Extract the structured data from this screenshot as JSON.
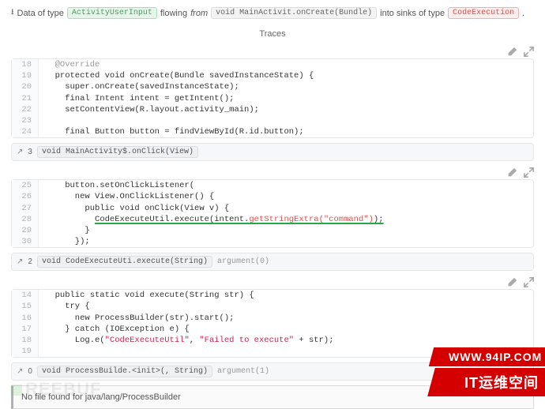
{
  "header": {
    "prefix": "Data of type",
    "sourceTag": "ActivityUserInput",
    "mid1": "flowing",
    "mid1i": "from",
    "methodTag": "void MainActivit.onCreate(Bundle)",
    "mid2": "into sinks of type",
    "sinkTag": "CodeExecution",
    "period": "."
  },
  "tracesTitle": "Traces",
  "code1": [
    {
      "n": "18",
      "t": "  @Override",
      "cls": "ann"
    },
    {
      "n": "19",
      "t": "  protected void onCreate(Bundle savedInstanceState) {"
    },
    {
      "n": "20",
      "t": "    super.onCreate(savedInstanceState);"
    },
    {
      "n": "21",
      "t": "    final Intent intent = getIntent();"
    },
    {
      "n": "22",
      "t": "    setContentView(R.layout.activity_main);"
    },
    {
      "n": "23",
      "t": ""
    },
    {
      "n": "24",
      "t": "    final Button button = findViewById(R.id.button);"
    }
  ],
  "sep1": {
    "num": "3",
    "code": "void MainActivity$.onClick(View)"
  },
  "code2": [
    {
      "n": "25",
      "t": "    button.setOnClickListener("
    },
    {
      "n": "26",
      "t": "      new View.OnClickListener() {"
    },
    {
      "n": "27",
      "t": "        public void onClick(View v) {"
    },
    {
      "n": "28",
      "pre": "          ",
      "u1": "CodeExecuteUtil.execute(",
      "u2": "intent.",
      "hl": "getStringExtra(\"command\")",
      "u3": ");"
    },
    {
      "n": "29",
      "t": "        }"
    },
    {
      "n": "30",
      "t": "      });"
    },
    {
      "n": "",
      "t": ""
    }
  ],
  "sep2": {
    "num": "2",
    "code": "void CodeExecuteUti.execute(String)",
    "arg": "argument(0)"
  },
  "code3": [
    {
      "n": "14",
      "t": "  public static void execute(String str) {"
    },
    {
      "n": "15",
      "t": "    try {"
    },
    {
      "n": "16",
      "t": "      new ProcessBuilder(str).start();"
    },
    {
      "n": "17",
      "t": "    } catch (IOException e) {"
    },
    {
      "n": "18",
      "pre": "      Log.e(",
      "s1": "\"CodeExecuteUtil\"",
      "c": ", ",
      "s2": "\"Failed to execute\"",
      "post": " + str);"
    },
    {
      "n": "19",
      "t": ""
    }
  ],
  "sep3": {
    "num": "0",
    "code": "void ProcessBuilde.<init>(, String)",
    "arg": "argument(1)"
  },
  "warn": "No file found for java/lang/ProcessBuilder",
  "watermark": "REEBUF",
  "banner": {
    "top": "WWW.94IP.COM",
    "bot": "IT运维空间"
  }
}
